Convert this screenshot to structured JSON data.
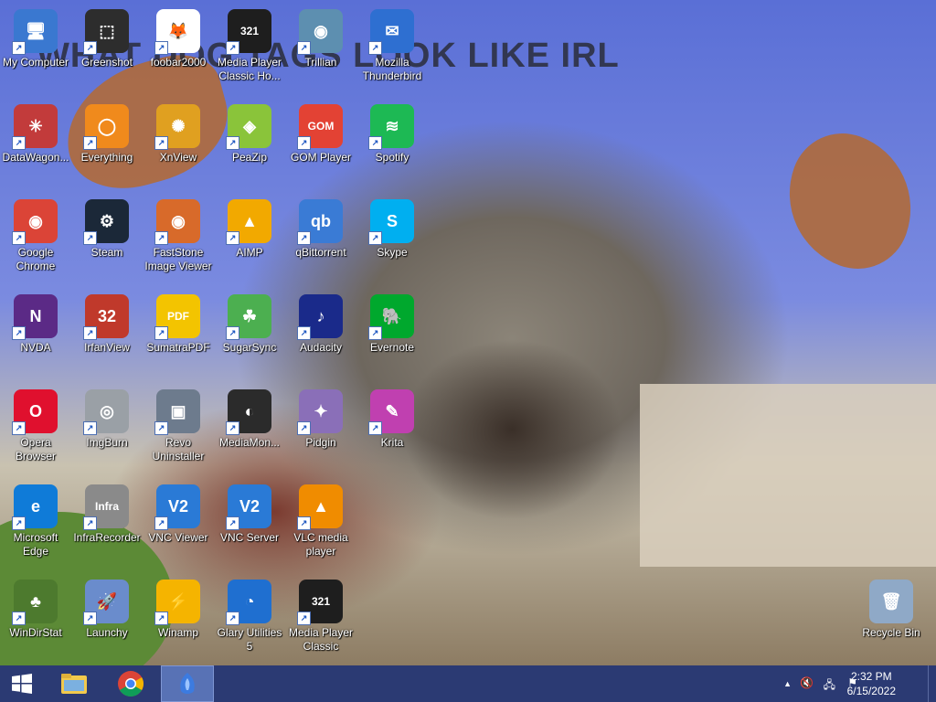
{
  "wallpaper": {
    "caption": "WHAT DOG TAGS LOOK LIKE IRL"
  },
  "icons": [
    {
      "label": "My Computer",
      "icon": "computer-icon",
      "color": "#3a78d0"
    },
    {
      "label": "Greenshot",
      "icon": "greenshot-icon",
      "color": "#2d2d2d"
    },
    {
      "label": "foobar2000",
      "icon": "foobar-icon",
      "color": "#ffffff"
    },
    {
      "label": "Media Player Classic Ho...",
      "icon": "mpc-hc-icon",
      "color": "#1e1e1e"
    },
    {
      "label": "Trillian",
      "icon": "trillian-icon",
      "color": "#5d8fb0"
    },
    {
      "label": "Mozilla Thunderbird",
      "icon": "thunderbird-icon",
      "color": "#2e6fd1"
    },
    {
      "label": "DataWagon...",
      "icon": "datawagon-icon",
      "color": "#c23b3b"
    },
    {
      "label": "Everything",
      "icon": "everything-icon",
      "color": "#f08a1c"
    },
    {
      "label": "XnView",
      "icon": "xnview-icon",
      "color": "#e0a020"
    },
    {
      "label": "PeaZip",
      "icon": "peazip-icon",
      "color": "#8ac43a"
    },
    {
      "label": "GOM Player",
      "icon": "gom-icon",
      "color": "#e34234"
    },
    {
      "label": "Spotify",
      "icon": "spotify-icon",
      "color": "#1db954"
    },
    {
      "label": "Google Chrome",
      "icon": "chrome-icon",
      "color": "#db4437"
    },
    {
      "label": "Steam",
      "icon": "steam-icon",
      "color": "#1b2838"
    },
    {
      "label": "FastStone Image Viewer",
      "icon": "faststone-icon",
      "color": "#d86a2a"
    },
    {
      "label": "AIMP",
      "icon": "aimp-icon",
      "color": "#f2a900"
    },
    {
      "label": "qBittorrent",
      "icon": "qbittorrent-icon",
      "color": "#3a7bd5"
    },
    {
      "label": "Skype",
      "icon": "skype-icon",
      "color": "#00aff0"
    },
    {
      "label": "NVDA",
      "icon": "nvda-icon",
      "color": "#5b2a86"
    },
    {
      "label": "IrfanView",
      "icon": "irfanview-icon",
      "color": "#c0392b"
    },
    {
      "label": "SumatraPDF",
      "icon": "sumatrapdf-icon",
      "color": "#f3c400"
    },
    {
      "label": "SugarSync",
      "icon": "sugarsync-icon",
      "color": "#4caf50"
    },
    {
      "label": "Audacity",
      "icon": "audacity-icon",
      "color": "#1a2a8a"
    },
    {
      "label": "Evernote",
      "icon": "evernote-icon",
      "color": "#00a82d"
    },
    {
      "label": "Opera Browser",
      "icon": "opera-icon",
      "color": "#e0102e"
    },
    {
      "label": "ImgBurn",
      "icon": "imgburn-icon",
      "color": "#9aa0a6"
    },
    {
      "label": "Revo Uninstaller",
      "icon": "revo-icon",
      "color": "#6d7b8d"
    },
    {
      "label": "MediaMon...",
      "icon": "mediamonkey-icon",
      "color": "#2b2b2b"
    },
    {
      "label": "Pidgin",
      "icon": "pidgin-icon",
      "color": "#8a6fb8"
    },
    {
      "label": "Krita",
      "icon": "krita-icon",
      "color": "#c040b0"
    },
    {
      "label": "Microsoft Edge",
      "icon": "edge-icon",
      "color": "#0f7bd8"
    },
    {
      "label": "InfraRecorder",
      "icon": "infrarecorder-icon",
      "color": "#8a8a8a"
    },
    {
      "label": "VNC Viewer",
      "icon": "vnc-viewer-icon",
      "color": "#2a7ad6"
    },
    {
      "label": "VNC Server",
      "icon": "vnc-server-icon",
      "color": "#2a7ad6"
    },
    {
      "label": "VLC media player",
      "icon": "vlc-icon",
      "color": "#f08c00"
    },
    {
      "label": "WinDirStat",
      "icon": "windirstat-icon",
      "color": "#4d7a2e"
    },
    {
      "label": "Launchy",
      "icon": "launchy-icon",
      "color": "#6a8ccc"
    },
    {
      "label": "Winamp",
      "icon": "winamp-icon",
      "color": "#f5b400"
    },
    {
      "label": "Glary Utilities 5",
      "icon": "glary-icon",
      "color": "#1f6fd0"
    },
    {
      "label": "Media Player Classic",
      "icon": "mpc-icon",
      "color": "#1e1e1e"
    },
    {
      "label": "Recycle Bin",
      "icon": "recycle-bin-icon",
      "color": "#8fa9c7"
    }
  ],
  "icon_glyphs": {
    "computer-icon": "🖥",
    "greenshot-icon": "⬚",
    "foobar-icon": "🦊",
    "mpc-hc-icon": "321",
    "trillian-icon": "◉",
    "thunderbird-icon": "✉",
    "datawagon-icon": "✳",
    "everything-icon": "◯",
    "xnview-icon": "✺",
    "peazip-icon": "◈",
    "gom-icon": "GOM",
    "spotify-icon": "≋",
    "chrome-icon": "◉",
    "steam-icon": "⚙",
    "faststone-icon": "◉",
    "aimp-icon": "▲",
    "qbittorrent-icon": "qb",
    "skype-icon": "S",
    "nvda-icon": "N",
    "irfanview-icon": "32",
    "sumatrapdf-icon": "PDF",
    "sugarsync-icon": "☘",
    "audacity-icon": "♪",
    "evernote-icon": "🐘",
    "opera-icon": "O",
    "imgburn-icon": "◎",
    "revo-icon": "▣",
    "mediamonkey-icon": "◐",
    "pidgin-icon": "✦",
    "krita-icon": "✎",
    "edge-icon": "e",
    "infrarecorder-icon": "Infra",
    "vnc-viewer-icon": "V2",
    "vnc-server-icon": "V2",
    "vlc-icon": "▲",
    "windirstat-icon": "♣",
    "launchy-icon": "🚀",
    "winamp-icon": "⚡",
    "glary-icon": "◔",
    "mpc-icon": "321",
    "recycle-bin-icon": "🗑"
  },
  "taskbar": {
    "start_icon": "windows-start-icon",
    "pinned": [
      {
        "name": "file-explorer",
        "icon": "folder-icon",
        "glyph": "📁"
      },
      {
        "name": "chrome",
        "icon": "chrome-icon",
        "glyph": "◉"
      },
      {
        "name": "active-app",
        "icon": "app-icon",
        "glyph": "🦊"
      }
    ],
    "tray": {
      "expand": "▲",
      "volume": "🔇",
      "network": "🖧",
      "flag": "⚑"
    },
    "clock": {
      "time": "2:32 PM",
      "date": "6/15/2022"
    }
  }
}
